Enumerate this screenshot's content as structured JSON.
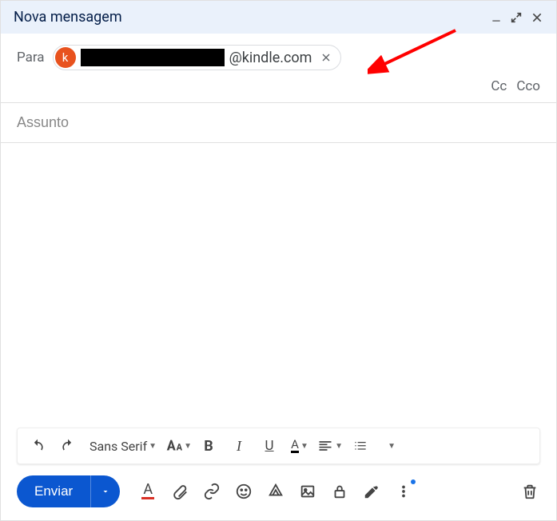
{
  "header": {
    "title": "Nova mensagem"
  },
  "to": {
    "label": "Para",
    "chip": {
      "avatar_letter": "k",
      "domain": "@kindle.com"
    }
  },
  "cc": {
    "cc": "Cc",
    "bcc": "Cco"
  },
  "subject": {
    "placeholder": "Assunto",
    "value": ""
  },
  "toolbar": {
    "font": "Sans Serif",
    "bold": "B",
    "italic": "I",
    "underline": "U",
    "color": "A"
  },
  "actions": {
    "send": "Enviar",
    "format": "A"
  }
}
